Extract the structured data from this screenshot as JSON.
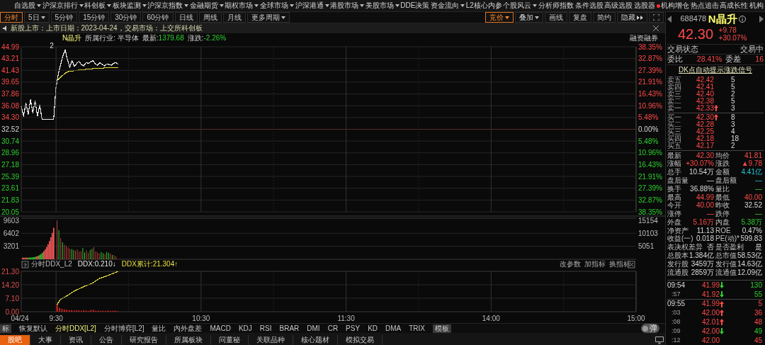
{
  "menu_bar": {
    "items": [
      {
        "label": "自选股",
        "dropdown": true,
        "dot": false
      },
      {
        "label": "沪深京排行",
        "dropdown": true,
        "dot": false
      },
      {
        "label": "科创板",
        "dropdown": true,
        "dot": false
      },
      {
        "label": "板块监测",
        "dropdown": true,
        "dot": false
      },
      {
        "label": "沪深京指数",
        "dropdown": true,
        "dot": false
      },
      {
        "label": "金融期货",
        "dropdown": true,
        "dot": false
      },
      {
        "label": "期权市场",
        "dropdown": true,
        "dot": false
      },
      {
        "label": "全球市场",
        "dropdown": true,
        "dot": false
      },
      {
        "label": "沪深港通",
        "dropdown": true,
        "dot": false
      },
      {
        "label": "港股市场",
        "dropdown": true,
        "dot": false
      },
      {
        "label": "美股市场",
        "dropdown": true,
        "dot": false
      },
      {
        "label": "DDE决策",
        "dropdown": false,
        "dot": false
      },
      {
        "label": "资金流向",
        "dropdown": true,
        "dot": false
      },
      {
        "label": "L2核心内参",
        "dropdown": false,
        "dot": false
      },
      {
        "label": "个股风云",
        "dropdown": true,
        "dot": false
      },
      {
        "label": "分析师指数",
        "dropdown": false,
        "dot": false
      },
      {
        "label": "条件选股",
        "dropdown": false,
        "dot": false
      },
      {
        "label": "高级选股",
        "dropdown": false,
        "dot": false
      },
      {
        "label": "选股器",
        "dropdown": false,
        "dot": true
      },
      {
        "label": "机构增仓",
        "dropdown": false,
        "dot": false
      },
      {
        "label": "热点追击",
        "dropdown": false,
        "dot": false
      },
      {
        "label": "高成长性",
        "dropdown": false,
        "dot": false
      },
      {
        "label": "机构",
        "dropdown": false,
        "dot": false
      }
    ]
  },
  "period_tabs": [
    {
      "label": "分时",
      "selected": true,
      "dropdown": false
    },
    {
      "label": "5日",
      "selected": false,
      "dropdown": true
    },
    {
      "label": "5分钟",
      "selected": false,
      "dropdown": false
    },
    {
      "label": "15分钟",
      "selected": false,
      "dropdown": false
    },
    {
      "label": "30分钟",
      "selected": false,
      "dropdown": false
    },
    {
      "label": "60分钟",
      "selected": false,
      "dropdown": false
    },
    {
      "label": "日线",
      "selected": false,
      "dropdown": false
    },
    {
      "label": "周线",
      "selected": false,
      "dropdown": false
    },
    {
      "label": "月线",
      "selected": false,
      "dropdown": false
    },
    {
      "label": "更多周期",
      "selected": false,
      "dropdown": true
    }
  ],
  "chart_tools": [
    {
      "label": "竞价",
      "selected": true,
      "dropdown": true,
      "expand": false
    },
    {
      "label": "叠加",
      "selected": false,
      "dropdown": true,
      "expand": false
    },
    {
      "label": "画线",
      "selected": false,
      "dropdown": false,
      "expand": false
    },
    {
      "label": "复盘",
      "selected": false,
      "dropdown": false,
      "expand": false
    },
    {
      "label": "简约",
      "selected": false,
      "dropdown": false,
      "expand": false
    },
    {
      "label": "隐藏",
      "selected": false,
      "dropdown": false,
      "expand": true
    }
  ],
  "notice": {
    "text": "新股上市：上市日期：2023-04-24，交易市场：上交所科创板"
  },
  "info_line": {
    "name": "N晶升",
    "industry": "所属行业: 半导体",
    "latest_label": "最新:",
    "latest": "1379.68",
    "change_label": "涨跌:",
    "change": "-2.26%",
    "link": "融资融券"
  },
  "price_chart": {
    "event_marker": "2",
    "date_label": "04/24",
    "right_axis": [
      "38.35%",
      "32.87%",
      "27.39%",
      "21.91%",
      "16.43%",
      "10.96%",
      "5.48%",
      "0.00%",
      "5.48%",
      "10.96%",
      "16.43%",
      "21.91%",
      "27.39%",
      "32.87%",
      "38.35%"
    ],
    "chart_data": {
      "type": "line",
      "categories": [
        null,
        null,
        null,
        null,
        null,
        null,
        null,
        null,
        null,
        null,
        null,
        null,
        null,
        null,
        null,
        null,
        null,
        null,
        null,
        null,
        null,
        null,
        null,
        null,
        null,
        null,
        null,
        null,
        null,
        null,
        null,
        null,
        null,
        null,
        null,
        null,
        null,
        null,
        null,
        null,
        null,
        null,
        null
      ],
      "series": [
        {
          "color": "#f0f0f0",
          "values": [
            36.0,
            34.5,
            36.5,
            34.8,
            37.0,
            35.0,
            36.8,
            34.5,
            36.2,
            34.0,
            34.0,
            34.0,
            34.0,
            34.0,
            34.0,
            38.8,
            40.8,
            42.3,
            43.6,
            44.5,
            43.0,
            41.9,
            42.9,
            42.0,
            42.5,
            42.8,
            42.3,
            42.1,
            42.6,
            42.5,
            42.7,
            42.9,
            42.4,
            42.2,
            42.6,
            42.3,
            42.1,
            42.4,
            42.3,
            42.2,
            42.5,
            42.6,
            42.3
          ]
        },
        {
          "color": "#e8e040",
          "values": [
            null,
            null,
            null,
            null,
            null,
            null,
            null,
            null,
            null,
            null,
            null,
            null,
            null,
            null,
            null,
            null,
            40.0,
            40.4,
            40.7,
            41.0,
            41.2,
            41.3,
            41.3,
            41.4,
            41.4,
            41.5,
            41.5,
            41.5,
            41.6,
            41.6,
            41.6,
            41.7,
            41.7,
            41.7,
            41.7,
            41.7,
            41.8,
            41.8,
            41.8,
            41.8,
            41.8,
            41.8,
            41.8
          ]
        }
      ],
      "ylim": [
        20.05,
        44.99
      ],
      "yticks": [
        {
          "value": 44.99,
          "label": "44.99"
        },
        {
          "value": 43.21,
          "label": "43.21"
        },
        {
          "value": 41.43,
          "label": "41.43"
        },
        {
          "value": 39.65,
          "label": "39.65"
        },
        {
          "value": 37.86,
          "label": "37.86"
        },
        {
          "value": 36.08,
          "label": "36.08"
        },
        {
          "value": 34.3,
          "label": "34.30"
        },
        {
          "value": 32.52,
          "label": "32.52"
        },
        {
          "value": 30.74,
          "label": "30.74"
        },
        {
          "value": 28.96,
          "label": "28.96"
        },
        {
          "value": 27.18,
          "label": "27.18"
        },
        {
          "value": 25.39,
          "label": "25.39"
        },
        {
          "value": 23.61,
          "label": "23.61"
        },
        {
          "value": 21.83,
          "label": "21.83"
        },
        {
          "value": 20.05,
          "label": "20.05"
        }
      ]
    }
  },
  "volume_chart": {
    "left_axis": [
      "9603",
      "6402",
      "3201"
    ],
    "right_axis": [
      "15154",
      "10103",
      "5051"
    ]
  },
  "ddx_panel": {
    "help": "?",
    "title": "分时DDX_L2",
    "ddx": "DDX:0.210↓",
    "ddx_total": "DDX累计:21.304↑",
    "actions": [
      "改参数",
      "加指标",
      "换指标"
    ],
    "time_axis_afternoon": [
      "14:00",
      "15:00"
    ],
    "chart_data": {
      "type": "line",
      "x": [
        9.505,
        9.53,
        9.578,
        9.627,
        9.7,
        9.75,
        9.798,
        9.847,
        9.93
      ],
      "series": [
        {
          "color": "#e8e040",
          "values": [
            3.5,
            6.5,
            8.5,
            11,
            13.5,
            15,
            17.5,
            18.8,
            21.3
          ]
        }
      ],
      "xlim": [
        9.26,
        13.5
      ],
      "ylim": [
        0,
        21.3
      ],
      "xticks": [
        {
          "value": 9.5,
          "label": "9:30"
        },
        {
          "value": 10.5,
          "label": "10:30"
        },
        {
          "value": 11.5,
          "label": "11:30"
        }
      ],
      "yticks": [
        {
          "value": 21.3,
          "label": "21.30"
        },
        {
          "value": 14.2,
          "label": "14.20"
        },
        {
          "value": 7.1,
          "label": "7.10"
        },
        {
          "value": 0,
          "label": "0.00"
        }
      ]
    }
  },
  "indicator_tabs": [
    {
      "label": "标",
      "kind": "button",
      "selected": false
    },
    {
      "label": "恢复默认",
      "kind": "tab",
      "selected": false
    },
    {
      "label": "分时DDX[L2]",
      "kind": "tab",
      "selected": true
    },
    {
      "label": "分时博弈[L2]",
      "kind": "tab",
      "selected": false
    },
    {
      "label": "量比",
      "kind": "tab",
      "selected": false
    },
    {
      "label": "内外盘差",
      "kind": "tab",
      "selected": false
    },
    {
      "label": "MACD",
      "kind": "tab",
      "selected": false
    },
    {
      "label": "KDJ",
      "kind": "tab",
      "selected": false
    },
    {
      "label": "RSI",
      "kind": "tab",
      "selected": false
    },
    {
      "label": "BRAR",
      "kind": "tab",
      "selected": false
    },
    {
      "label": "DMI",
      "kind": "tab",
      "selected": false
    },
    {
      "label": "CR",
      "kind": "tab",
      "selected": false
    },
    {
      "label": "PSY",
      "kind": "tab",
      "selected": false
    },
    {
      "label": "KD",
      "kind": "tab",
      "selected": false
    },
    {
      "label": "DMA",
      "kind": "tab",
      "selected": false
    },
    {
      "label": "TRIX",
      "kind": "tab",
      "selected": false
    },
    {
      "label": "模板",
      "kind": "button",
      "selected": false
    }
  ],
  "popup_toggle": {
    "label": "弹",
    "on": false
  },
  "bottom_tabs": [
    {
      "label": "股吧",
      "selected": true
    },
    {
      "label": "大事",
      "selected": false
    },
    {
      "label": "资讯",
      "selected": false
    },
    {
      "label": "公告",
      "selected": false
    },
    {
      "label": "研究报告",
      "selected": false
    },
    {
      "label": "所属板块",
      "selected": false
    },
    {
      "label": "问董秘",
      "selected": false
    },
    {
      "label": "关联品种",
      "selected": false
    },
    {
      "label": "核心题材",
      "selected": false
    },
    {
      "label": "模拟交易",
      "selected": false
    }
  ],
  "quote": {
    "code": "688478",
    "name": "N晶升",
    "price": "42.30",
    "change": "+9.78",
    "change_pct": "+30.07%"
  },
  "status": {
    "label": "交易状态",
    "value": "交易中"
  },
  "order_ratio": [
    {
      "label": "委比",
      "value": "28.41%"
    },
    {
      "label": "委差",
      "value": "16"
    }
  ],
  "signal_link": "DK点自动提示涨跌信号",
  "asks": [
    {
      "label": "卖五",
      "price": "42.42",
      "up_arrow": false,
      "volume": "5"
    },
    {
      "label": "卖四",
      "price": "42.41",
      "up_arrow": false,
      "volume": "5"
    },
    {
      "label": "卖三",
      "price": "42.40",
      "up_arrow": false,
      "volume": "2"
    },
    {
      "label": "卖二",
      "price": "42.38",
      "up_arrow": false,
      "volume": "5"
    },
    {
      "label": "卖一",
      "price": "42.33",
      "up_arrow": true,
      "volume": "3"
    }
  ],
  "bids": [
    {
      "label": "买一",
      "price": "42.30",
      "up_arrow": true,
      "volume": "8"
    },
    {
      "label": "买二",
      "price": "42.28",
      "up_arrow": false,
      "volume": "3"
    },
    {
      "label": "买三",
      "price": "42.25",
      "up_arrow": false,
      "volume": "4"
    },
    {
      "label": "买四",
      "price": "42.18",
      "up_arrow": false,
      "volume": "18"
    },
    {
      "label": "买五",
      "price": "42.17",
      "up_arrow": false,
      "volume": "2"
    }
  ],
  "stats": [
    [
      {
        "label": "最新",
        "value": "42.30",
        "kind": "rise"
      },
      {
        "label": "均价",
        "value": "41.81",
        "kind": "rise"
      }
    ],
    [
      {
        "label": "涨幅",
        "value": "+30.07%",
        "kind": "rise"
      },
      {
        "label": "涨跌",
        "value": "▲9.78",
        "kind": "rise"
      }
    ],
    [
      {
        "label": "总手",
        "value": "10.54万",
        "kind": "plain"
      },
      {
        "label": "金额",
        "value": "4.41亿",
        "kind": "amount"
      }
    ],
    [
      {
        "label": "盘后量",
        "value": "—",
        "kind": "plain"
      },
      {
        "label": "盘后额",
        "value": "—",
        "kind": "amount"
      }
    ],
    [
      {
        "label": "换手",
        "value": "36.88%",
        "kind": "plain"
      },
      {
        "label": "量比",
        "value": "—",
        "kind": "fall"
      }
    ],
    [
      {
        "label": "最高",
        "value": "44.99",
        "kind": "rise"
      },
      {
        "label": "最低",
        "value": "40.00",
        "kind": "rise"
      }
    ],
    [
      {
        "label": "今开",
        "value": "40.00",
        "kind": "rise"
      },
      {
        "label": "昨收",
        "value": "32.52",
        "kind": "plain"
      }
    ],
    [
      {
        "label": "涨停",
        "value": "—",
        "kind": "rise"
      },
      {
        "label": "跌停",
        "value": "—",
        "kind": "fall"
      }
    ],
    [
      {
        "label": "外盘",
        "value": "5.16万",
        "kind": "rise"
      },
      {
        "label": "内盘",
        "value": "5.38万",
        "kind": "fall"
      }
    ],
    [
      {
        "label": "净资产",
        "value": "11.13",
        "kind": "plain"
      },
      {
        "label": "ROE",
        "value": "0.47%",
        "kind": "plain"
      }
    ],
    [
      {
        "label": "收益(一)",
        "value": "0.018",
        "kind": "plain"
      },
      {
        "label": "PE(动)*",
        "value": "599.83",
        "kind": "plain"
      }
    ],
    [
      {
        "label": "表决权差异",
        "value": "否",
        "kind": "plain"
      },
      {
        "label": "是否盈利",
        "value": "是",
        "kind": "plain"
      }
    ],
    [
      {
        "label": "总股本",
        "value": "1.384亿",
        "kind": "plain"
      },
      {
        "label": "总市值",
        "value": "58.53亿",
        "kind": "plain"
      }
    ],
    [
      {
        "label": "发行股",
        "value": "3459万",
        "kind": "plain"
      },
      {
        "label": "发行值",
        "value": "14.63亿",
        "kind": "plain"
      }
    ],
    [
      {
        "label": "流通股",
        "value": "2859万",
        "kind": "plain"
      },
      {
        "label": "流通值",
        "value": "12.09亿",
        "kind": "plain"
      }
    ]
  ],
  "ticks": [
    {
      "time": "09:54",
      "minor": false,
      "group_start": false,
      "price": "41.99",
      "up_arrow": false,
      "down_arrow": true,
      "volume": "130",
      "kind": "sell"
    },
    {
      "time": ":57",
      "minor": true,
      "group_start": false,
      "price": "41.92",
      "up_arrow": false,
      "down_arrow": true,
      "volume": "55",
      "kind": "sell"
    },
    {
      "time": "09:55",
      "minor": false,
      "group_start": true,
      "price": "41.99",
      "up_arrow": true,
      "down_arrow": false,
      "volume": "5",
      "kind": "buy"
    },
    {
      "time": ":03",
      "minor": true,
      "group_start": false,
      "price": "42.00",
      "up_arrow": true,
      "down_arrow": false,
      "volume": "36",
      "kind": "buy"
    },
    {
      "time": ":08",
      "minor": true,
      "group_start": false,
      "price": "42.01",
      "up_arrow": true,
      "down_arrow": false,
      "volume": "48",
      "kind": "buy"
    },
    {
      "time": ":09",
      "minor": true,
      "group_start": false,
      "price": "42.00",
      "up_arrow": false,
      "down_arrow": true,
      "volume": "49",
      "kind": "sell"
    },
    {
      "time": ":12",
      "minor": true,
      "group_start": false,
      "price": "42.00",
      "up_arrow": false,
      "down_arrow": false,
      "volume": "45",
      "kind": "buy"
    }
  ]
}
